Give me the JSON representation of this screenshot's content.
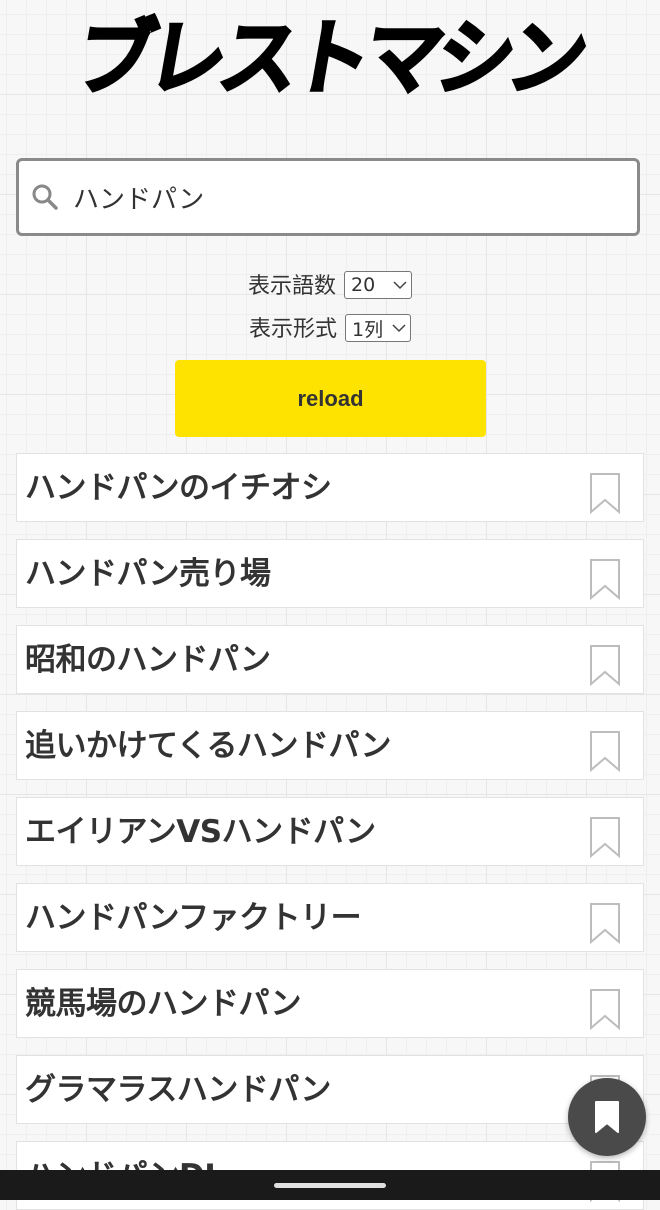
{
  "app": {
    "logo_text": "ブレストマシン"
  },
  "search": {
    "value": "ハンドパン",
    "icon": "search-icon"
  },
  "options": {
    "count_label": "表示語数",
    "count_value": "20",
    "format_label": "表示形式",
    "format_value": "1列"
  },
  "reload": {
    "label": "reload"
  },
  "results": [
    {
      "label": "ハンドパンのイチオシ"
    },
    {
      "label": "ハンドパン売り場"
    },
    {
      "label": "昭和のハンドパン"
    },
    {
      "label": "追いかけてくるハンドパン"
    },
    {
      "label": "エイリアンVSハンドパン"
    },
    {
      "label": "ハンドパンファクトリー"
    },
    {
      "label": "競馬場のハンドパン"
    },
    {
      "label": "グラマラスハンドパン"
    },
    {
      "label": "ハンドパンDJ"
    }
  ],
  "colors": {
    "accent": "#ffe300",
    "fab": "#4a4a4a"
  },
  "fab": {
    "icon": "bookmark-icon"
  }
}
